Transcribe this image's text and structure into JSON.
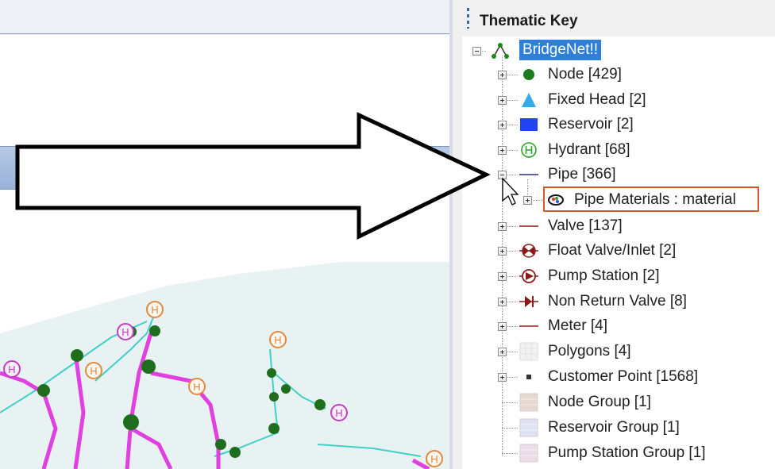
{
  "panel": {
    "title": "Thematic Key"
  },
  "tree": {
    "root": {
      "label": "BridgeNet!!",
      "icon": "network-icon"
    },
    "items": [
      {
        "label": "Node [429]",
        "icon": "node-dot-icon",
        "color": "#1e7a1e"
      },
      {
        "label": "Fixed Head [2]",
        "icon": "triangle-icon",
        "color": "#33aaee"
      },
      {
        "label": "Reservoir [2]",
        "icon": "square-icon",
        "color": "#2244ee"
      },
      {
        "label": "Hydrant [68]",
        "icon": "hydrant-icon",
        "color": "#2aa32a"
      },
      {
        "label": "Pipe [366]",
        "icon": "line-icon",
        "color": "#2c2c8c"
      },
      {
        "label": "Pipe Materials : material",
        "icon": "eye-palette-icon"
      },
      {
        "label": "Valve [137]",
        "icon": "line-icon",
        "color": "#8b1a1a"
      },
      {
        "label": "Float Valve/Inlet [2]",
        "icon": "float-valve-icon",
        "color": "#8b1a1a"
      },
      {
        "label": "Pump Station [2]",
        "icon": "pump-icon",
        "color": "#8b1a1a"
      },
      {
        "label": "Non Return Valve [8]",
        "icon": "non-return-valve-icon",
        "color": "#8b1a1a"
      },
      {
        "label": "Meter [4]",
        "icon": "line-icon",
        "color": "#8b1a1a"
      },
      {
        "label": "Polygons [4]",
        "icon": "polygon-pattern-icon"
      },
      {
        "label": "Customer Point [1568]",
        "icon": "small-square-icon",
        "color": "#333333"
      },
      {
        "label": "Node Group [1]",
        "icon": "group-pattern-icon",
        "color": "#e6d8d0"
      },
      {
        "label": "Reservoir Group [1]",
        "icon": "group-pattern-icon",
        "color": "#dfe2f2"
      },
      {
        "label": "Pump Station Group [1]",
        "icon": "group-pattern-icon",
        "color": "#ecdce8"
      }
    ]
  },
  "map": {
    "hydrant_symbol": "H"
  },
  "colors": {
    "selection": "#2f7fd9",
    "highlight_box": "#d55a2a",
    "main_pipe": "#e040e0",
    "branch_pipe": "#40d0c8"
  }
}
